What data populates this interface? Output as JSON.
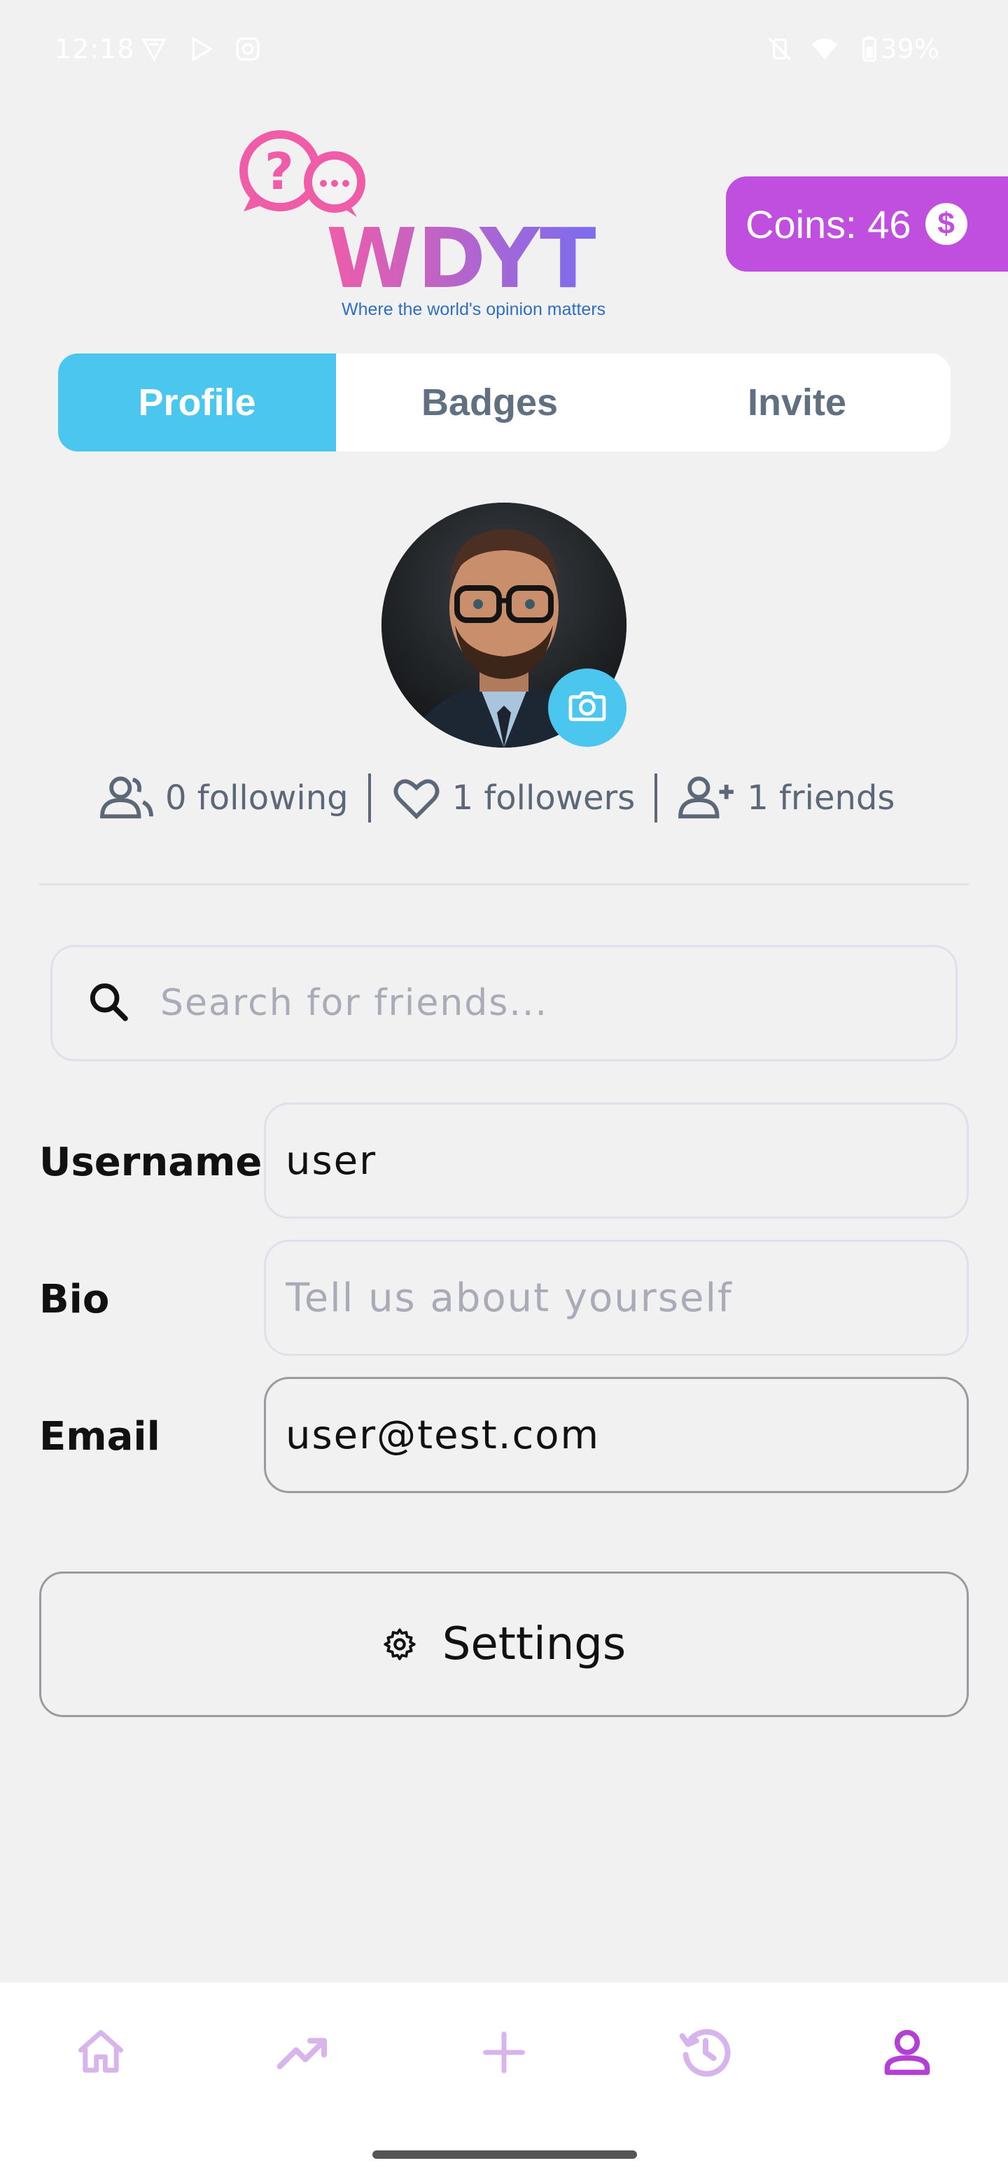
{
  "status_bar": {
    "time": "12:18",
    "battery": "39%",
    "icons": [
      "vpn-icon",
      "play-store-icon",
      "instagram-icon",
      "vibrate-off-icon",
      "wifi-icon",
      "battery-icon"
    ]
  },
  "header": {
    "logo_text": "WDYT",
    "logo_tagline": "Where the world's opinion matters",
    "coins_label": "Coins: 46",
    "coin_symbol": "$"
  },
  "tabs": [
    {
      "label": "Profile",
      "active": true
    },
    {
      "label": "Badges",
      "active": false
    },
    {
      "label": "Invite",
      "active": false
    }
  ],
  "stats": {
    "following": "0 following",
    "followers": "1 followers",
    "friends": "1  friends"
  },
  "search": {
    "placeholder": "Search for friends...",
    "value": ""
  },
  "form": {
    "username_label": "Username",
    "username_value": "user",
    "bio_label": "Bio",
    "bio_placeholder": "Tell us about yourself",
    "email_label": "Email",
    "email_value": "user@test.com"
  },
  "settings_label": "Settings",
  "bottom_nav": [
    {
      "icon": "home-icon",
      "active": false
    },
    {
      "icon": "trending-icon",
      "active": false
    },
    {
      "icon": "plus-icon",
      "active": false
    },
    {
      "icon": "history-icon",
      "active": false
    },
    {
      "icon": "profile-icon",
      "active": true
    }
  ],
  "colors": {
    "accent_blue": "#4bc6ef",
    "coins_purple": "#c04fdf",
    "nav_inactive": "#d8b4ec",
    "nav_active": "#b43fd4"
  }
}
